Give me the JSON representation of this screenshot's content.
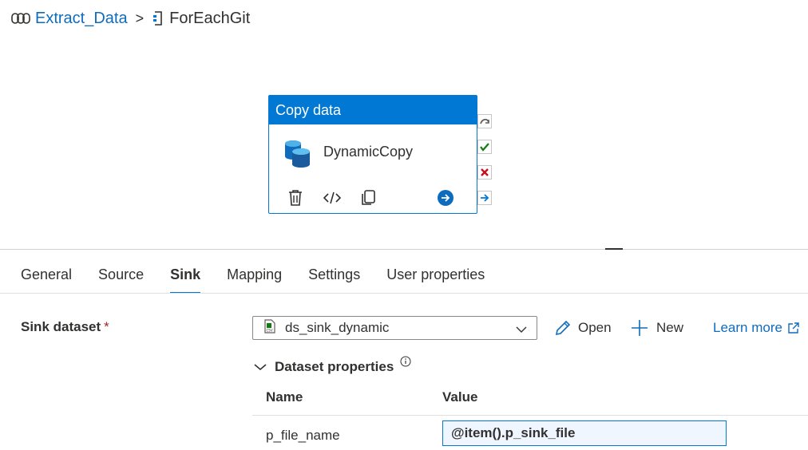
{
  "breadcrumb": {
    "pipeline": "Extract_Data",
    "separator": ">",
    "current": "ForEachGit"
  },
  "activity": {
    "type": "Copy data",
    "name": "DynamicCopy",
    "actions": [
      "delete-icon",
      "code-icon",
      "copy-icon",
      "go-icon"
    ],
    "ports": [
      "skip-port",
      "success-port",
      "failure-port",
      "completion-port"
    ],
    "accent": "#0078d4"
  },
  "tabs": [
    {
      "label": "General"
    },
    {
      "label": "Source"
    },
    {
      "label": "Sink",
      "active": true
    },
    {
      "label": "Mapping"
    },
    {
      "label": "Settings"
    },
    {
      "label": "User properties"
    }
  ],
  "sink": {
    "label": "Sink dataset",
    "required": "*",
    "dataset": "ds_sink_dynamic",
    "open_label": "Open",
    "new_label": "New",
    "learn_more": "Learn more",
    "dataset_properties": "Dataset properties",
    "table": {
      "col_name": "Name",
      "col_value": "Value",
      "rows": [
        {
          "name": "p_file_name",
          "value": "@item().p_sink_file"
        }
      ]
    }
  }
}
